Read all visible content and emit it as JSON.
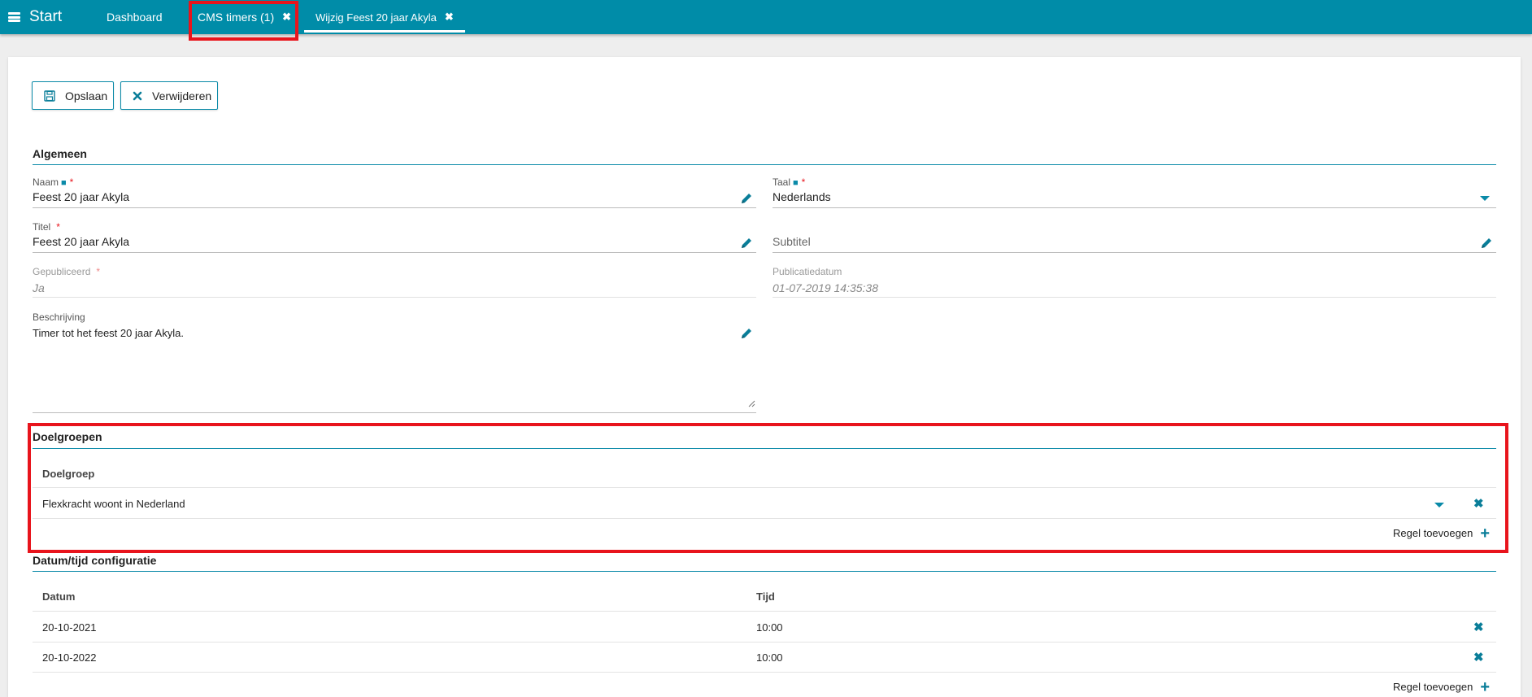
{
  "topbar": {
    "start_label": "Start",
    "tabs": [
      {
        "label": "Dashboard"
      },
      {
        "label": "CMS timers (1)",
        "close": "✖"
      },
      {
        "label": "Wijzig Feest 20 jaar Akyla",
        "close": "✖"
      }
    ]
  },
  "toolbar": {
    "save_label": "Opslaan",
    "delete_label": "Verwijderen"
  },
  "algemeen": {
    "title": "Algemeen",
    "naam": {
      "label": "Naam",
      "value": "Feest 20 jaar Akyla"
    },
    "taal": {
      "label": "Taal",
      "value": "Nederlands"
    },
    "titel": {
      "label": "Titel",
      "value": "Feest 20 jaar Akyla"
    },
    "subtitel": {
      "label": "Subtitel"
    },
    "gepubliceerd": {
      "label": "Gepubliceerd",
      "value": "Ja"
    },
    "publicatiedatum": {
      "label": "Publicatiedatum",
      "value": "01-07-2019 14:35:38"
    },
    "beschrijving": {
      "label": "Beschrijving",
      "value": "Timer tot het feest 20 jaar Akyla."
    }
  },
  "doelgroepen": {
    "title": "Doelgroepen",
    "column_header": "Doelgroep",
    "rows": [
      {
        "doelgroep": "Flexkracht woont in Nederland"
      }
    ],
    "add_label": "Regel toevoegen"
  },
  "datumtijd": {
    "title": "Datum/tijd configuratie",
    "columns": [
      "Datum",
      "Tijd"
    ],
    "rows": [
      {
        "datum": "20-10-2021",
        "tijd": "10:00"
      },
      {
        "datum": "20-10-2022",
        "tijd": "10:00"
      }
    ],
    "add_label": "Regel toevoegen"
  },
  "colors": {
    "accent": "#008ca8",
    "highlight": "#e8141c",
    "required": "#e8141c"
  },
  "icons": [
    "hamburger-icon",
    "close-icon",
    "save-icon",
    "delete-icon",
    "book-icon",
    "pencil-icon",
    "chevron-down-icon",
    "plus-icon"
  ]
}
